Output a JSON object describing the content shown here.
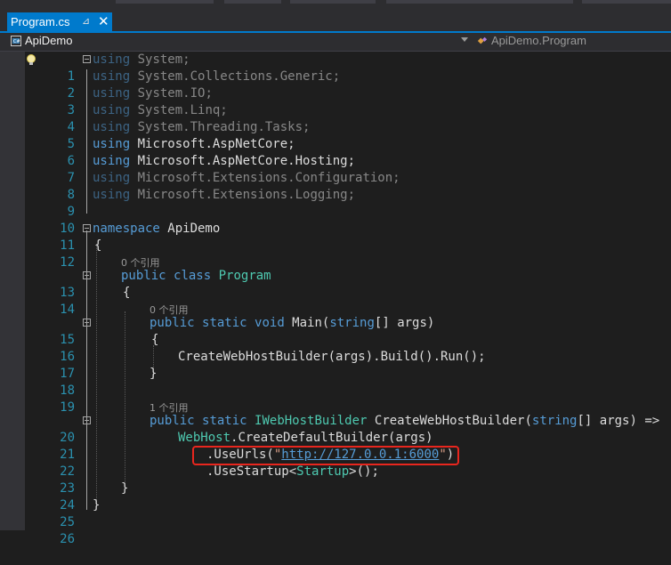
{
  "tab": {
    "title": "Program.cs",
    "pin": "⊿",
    "close": "✕"
  },
  "nav": {
    "project": "ApiDemo",
    "class": "ApiDemo.Program"
  },
  "lines": {
    "l1": "1",
    "l2": "2",
    "l3": "3",
    "l4": "4",
    "l5": "5",
    "l6": "6",
    "l7": "7",
    "l8": "8",
    "l9": "9",
    "l10": "10",
    "l11": "11",
    "l12": "12",
    "l13": "13",
    "l14": "14",
    "l15": "15",
    "l16": "16",
    "l17": "17",
    "l18": "18",
    "l19": "19",
    "l20": "20",
    "l21": "21",
    "l22": "22",
    "l23": "23",
    "l24": "24",
    "l25": "25",
    "l26": "26"
  },
  "code": {
    "using": "using",
    "u1": " System;",
    "u2": " System.Collections.Generic;",
    "u3": " System.IO;",
    "u4": " System.Linq;",
    "u5": " System.Threading.Tasks;",
    "u6": " Microsoft.AspNetCore;",
    "u7": " Microsoft.AspNetCore.Hosting;",
    "u8": " Microsoft.Extensions.Configuration;",
    "u9": " Microsoft.Extensions.Logging;",
    "namespace_kw": "namespace",
    "namespace_name": " ApiDemo",
    "open_brace": "{",
    "close_brace": "}",
    "public": "public",
    "class": "class",
    "static": "static",
    "void": "void",
    "string": "string",
    "program": "Program",
    "main": " Main(",
    "main_args": "[] args)",
    "create_call": "CreateWebHostBuilder(args).Build().Run();",
    "iwebhost": "IWebHostBuilder",
    "create_sig": " CreateWebHostBuilder(",
    "create_args": "[] args) =>",
    "webhost": "WebHost",
    "default_builder": ".CreateDefaultBuilder(args)",
    "useurls": ".UseUrls(",
    "url": "http://127.0.0.1:6000",
    "quote": "\"",
    "close_paren": ")",
    "usestartup": ".UseStartup<",
    "startup": "Startup",
    "usestartup_end": ">();"
  },
  "refs": {
    "zero": "0 个引用",
    "one": "1 个引用"
  }
}
